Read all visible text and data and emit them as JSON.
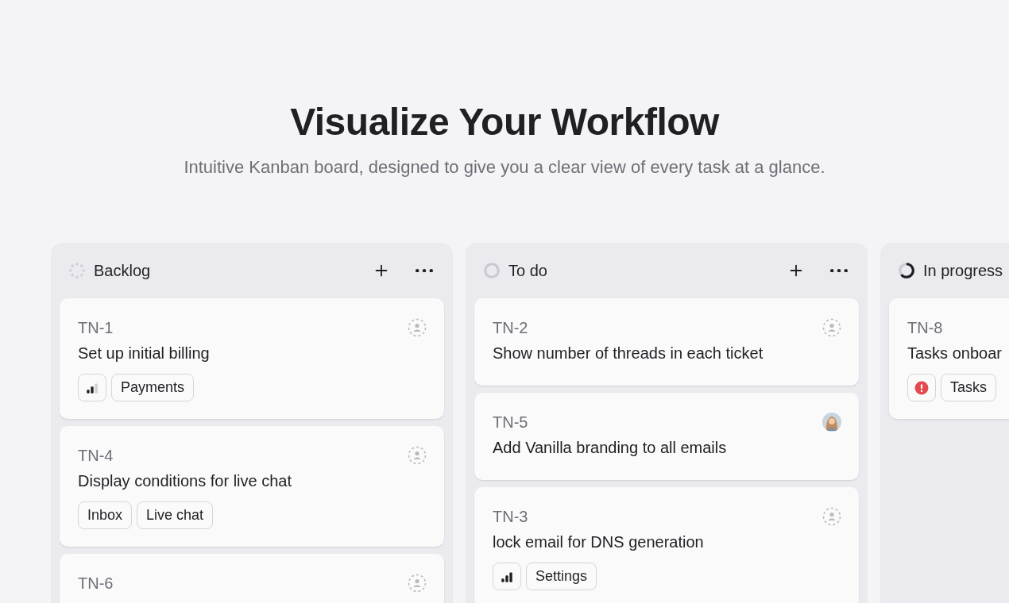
{
  "heading": {
    "title": "Visualize Your Workflow",
    "subtitle": "Intuitive Kanban board, designed to give you a clear view of every task at a glance."
  },
  "columns": [
    {
      "name": "Backlog",
      "kind": "backlog",
      "actions": true,
      "cards": [
        {
          "id": "TN-1",
          "title": "Set up initial billing",
          "assignee": {
            "kind": "unassigned"
          },
          "priority": {
            "kind": "medium"
          },
          "tags": [
            "Payments"
          ]
        },
        {
          "id": "TN-4",
          "title": "Display conditions for live chat",
          "assignee": {
            "kind": "unassigned"
          },
          "tags": [
            "Inbox",
            "Live chat"
          ]
        },
        {
          "id": "TN-6",
          "assignee": {
            "kind": "unassigned"
          }
        }
      ]
    },
    {
      "name": "To do",
      "kind": "todo",
      "actions": true,
      "cards": [
        {
          "id": "TN-2",
          "title": "Show number of threads in each ticket",
          "assignee": {
            "kind": "unassigned"
          }
        },
        {
          "id": "TN-5",
          "title": "Add Vanilla branding to all emails",
          "assignee": {
            "kind": "person"
          }
        },
        {
          "id": "TN-3",
          "title": "lock email for DNS generation",
          "assignee": {
            "kind": "unassigned"
          },
          "priority": {
            "kind": "high"
          },
          "tags": [
            "Settings"
          ]
        }
      ]
    },
    {
      "name": "In progress",
      "kind": "in_progress",
      "cards": [
        {
          "id": "TN-8",
          "title": "Tasks onboar",
          "priority": {
            "kind": "urgent"
          },
          "tags": [
            "Tasks"
          ]
        }
      ]
    }
  ]
}
